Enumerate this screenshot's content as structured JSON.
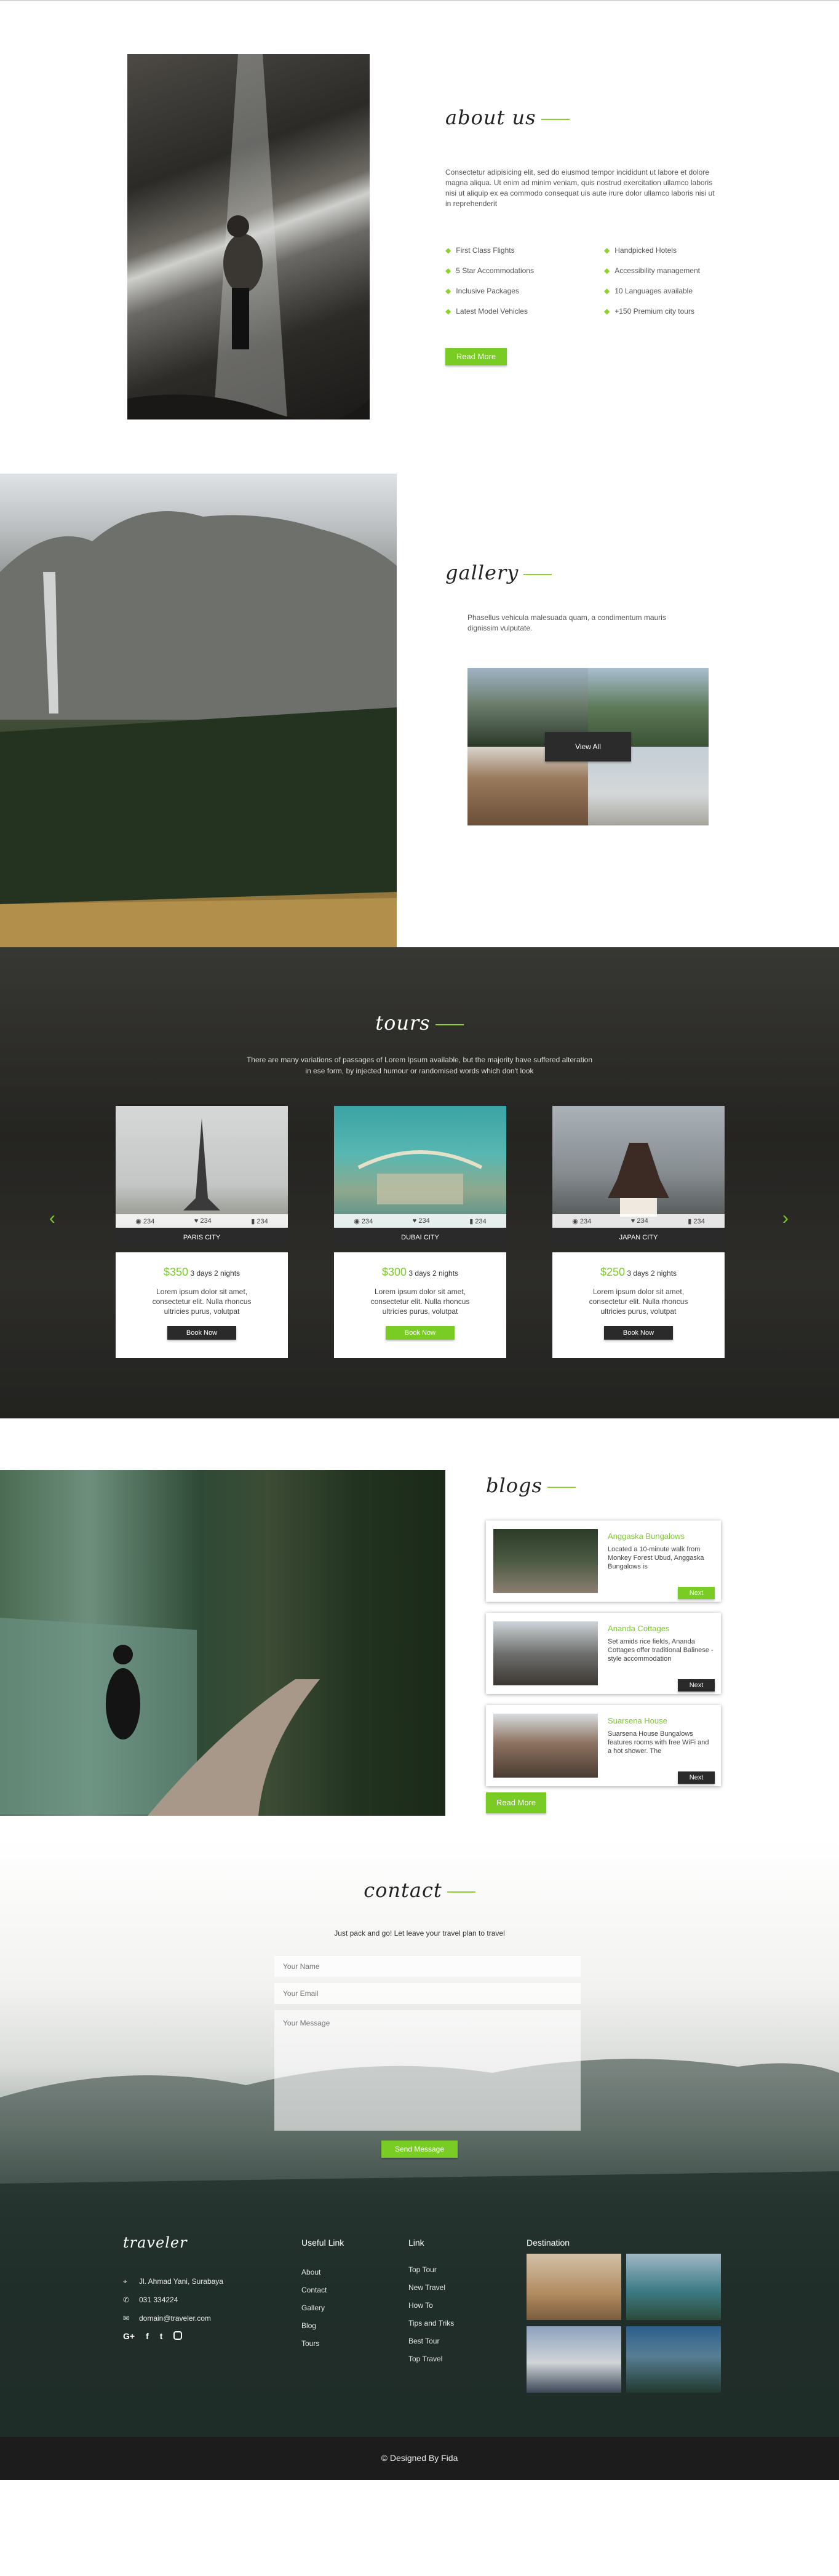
{
  "about": {
    "title": "about us",
    "text": "Consectetur adipisicing elit, sed do eiusmod tempor incididunt ut labore et dolore magna aliqua. Ut enim ad minim veniam, quis nostrud exercitation ullamco laboris nisi ut aliquip ex ea commodo consequat uis aute irure dolor ullamco laboris nisi ut in reprehenderit",
    "features": [
      "First Class Flights",
      "Handpicked Hotels",
      "5 Star Accommodations",
      "Accessibility management",
      "Inclusive Packages",
      "10 Languages available",
      "Latest Model Vehicles",
      "+150 Premium city tours"
    ],
    "button": "Read More"
  },
  "gallery": {
    "title": "gallery",
    "text": "Phasellus vehicula malesuada quam, a condimentum mauris dignissim vulputate.",
    "button": "View All"
  },
  "tours": {
    "title": "tours",
    "text_line1": "There are many variations of passages of Lorem Ipsum available, but the majority have suffered alteration",
    "text_line2": "in ese form, by injected humour or randomised words which don't look",
    "prev_icon": "chevron-left-icon",
    "next_icon": "chevron-right-icon",
    "cards": [
      {
        "city": "PARIS CITY",
        "views": "234",
        "likes": "234",
        "comments": "234",
        "price": "$350",
        "duration": "3 days 2 nights",
        "text": "Lorem ipsum dolor sit amet, consectetur elit. Nulla rhoncus ultricies purus, volutpat",
        "button": "Book Now",
        "active": false
      },
      {
        "city": "DUBAI CITY",
        "views": "234",
        "likes": "234",
        "comments": "234",
        "price": "$300",
        "duration": "3 days 2 nights",
        "text": "Lorem ipsum dolor sit amet, consectetur elit. Nulla rhoncus ultricies purus, volutpat",
        "button": "Book Now",
        "active": true
      },
      {
        "city": "JAPAN CITY",
        "views": "234",
        "likes": "234",
        "comments": "234",
        "price": "$250",
        "duration": "3 days 2 nights",
        "text": "Lorem ipsum dolor sit amet, consectetur elit. Nulla rhoncus ultricies purus, volutpat",
        "button": "Book Now",
        "active": false
      }
    ]
  },
  "blogs": {
    "title": "blogs",
    "posts": [
      {
        "title": "Anggaska Bungalows",
        "text": "Located a 10-minute walk from Monkey Forest Ubud, Anggaska Bungalows is",
        "button": "Next",
        "active": true
      },
      {
        "title": "Ananda Cottages",
        "text": "Set amids rice fields, Ananda Cottages offer traditional Balinese - style accommodation",
        "button": "Next",
        "active": false
      },
      {
        "title": "Suarsena House",
        "text": "Suarsena House Bungalows features rooms with free WiFi and a hot shower. The",
        "button": "Next",
        "active": false
      }
    ],
    "button": "Read More"
  },
  "contact": {
    "title": "contact",
    "subtitle": "Just pack and go! Let leave your travel plan to travel",
    "name_placeholder": "Your Name",
    "email_placeholder": "Your Email",
    "message_placeholder": "Your Message",
    "button": "Send Message"
  },
  "footer": {
    "brand": "traveler",
    "address": "Jl. Ahmad Yani, Surabaya",
    "phone": "031 334224",
    "email": "domain@traveler.com",
    "social": [
      "G+",
      "f",
      "t",
      "ig"
    ],
    "useful_title": "Useful Link",
    "useful_links": [
      "About",
      "Contact",
      "Gallery",
      "Blog",
      "Tours"
    ],
    "link_title": "Link",
    "links": [
      "Top Tour",
      "New Travel",
      "How To",
      "Tips and Triks",
      "Best Tour",
      "Top Travel"
    ],
    "destination_title": "Destination",
    "copyright": "© Designed By Fida"
  },
  "colors": {
    "accent": "#79cc24",
    "dark": "#2a2a2a",
    "footer_bar": "#1c1c1c"
  }
}
